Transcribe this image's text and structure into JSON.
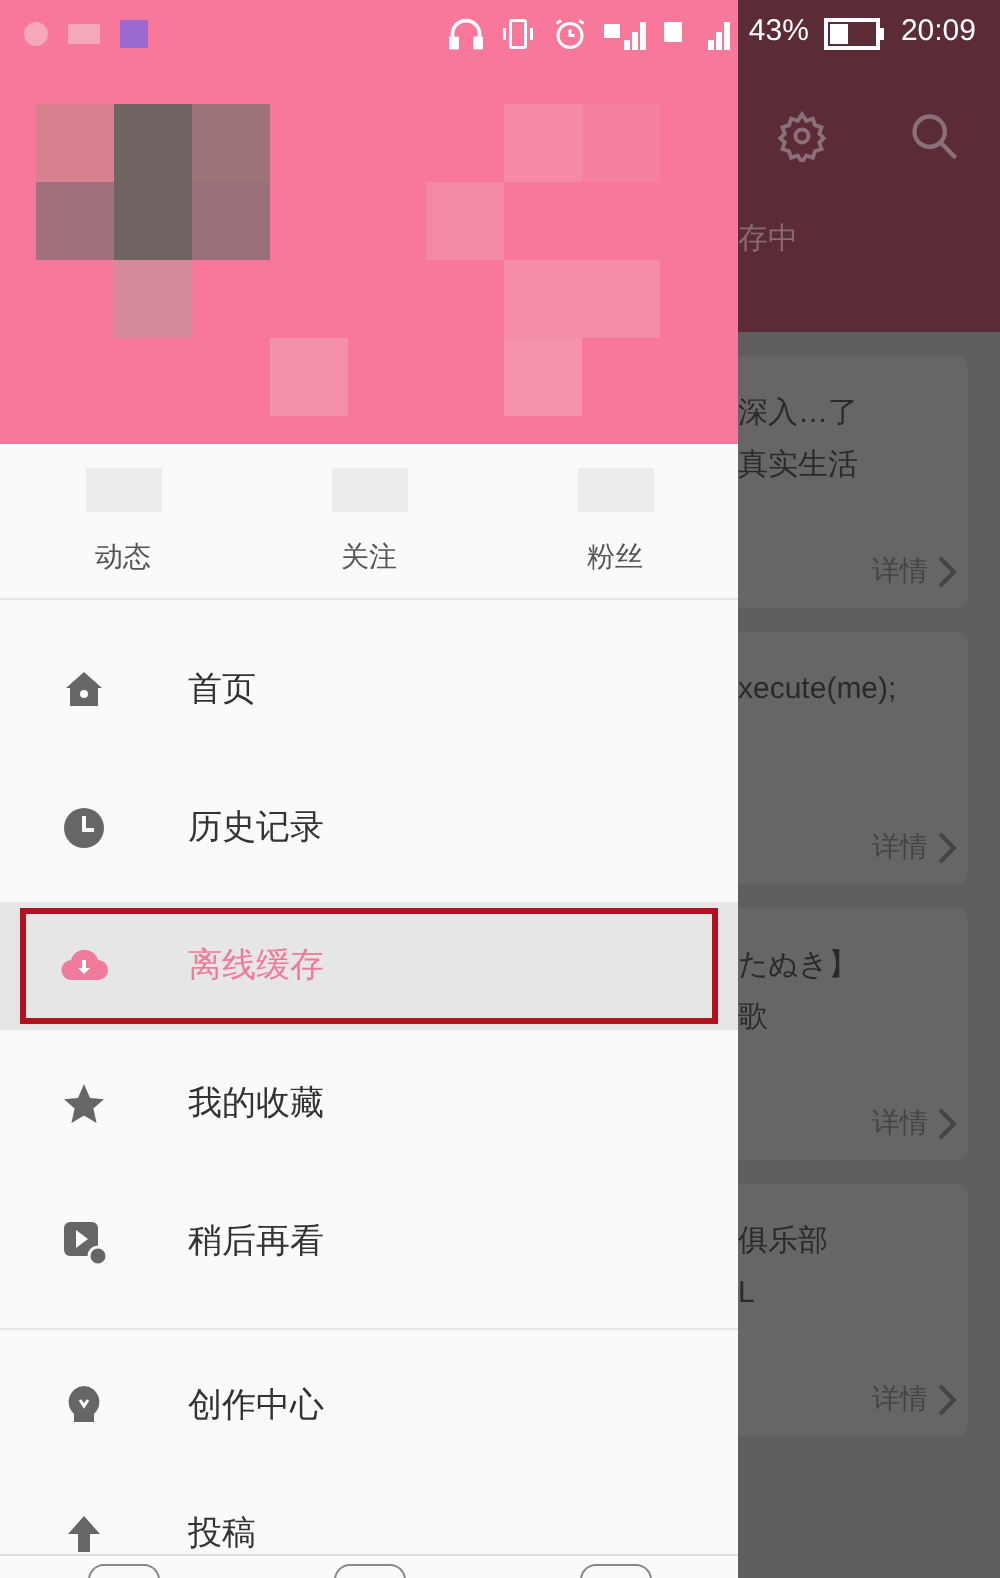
{
  "status_bar": {
    "battery": "43%",
    "time": "20:09"
  },
  "stats": [
    {
      "label": "动态"
    },
    {
      "label": "关注"
    },
    {
      "label": "粉丝"
    }
  ],
  "menu": [
    {
      "label": "首页",
      "selected": false
    },
    {
      "label": "历史记录",
      "selected": false
    },
    {
      "label": "离线缓存",
      "selected": true
    },
    {
      "label": "我的收藏",
      "selected": false
    },
    {
      "label": "稍后再看",
      "selected": false
    }
  ],
  "menu_2": [
    {
      "label": "创作中心",
      "selected": false
    },
    {
      "label": "投稿",
      "selected": false
    }
  ],
  "background": {
    "tab": "存中",
    "cards": [
      {
        "lines": [
          "深入…了",
          "真实生活"
        ],
        "link": "详情"
      },
      {
        "lines": [
          "xecute(me);"
        ],
        "link": "详情"
      },
      {
        "lines": [
          "たぬき】",
          "歌"
        ],
        "link": "详情"
      },
      {
        "lines": [
          "俱乐部",
          "L"
        ],
        "link": "详情"
      }
    ]
  }
}
